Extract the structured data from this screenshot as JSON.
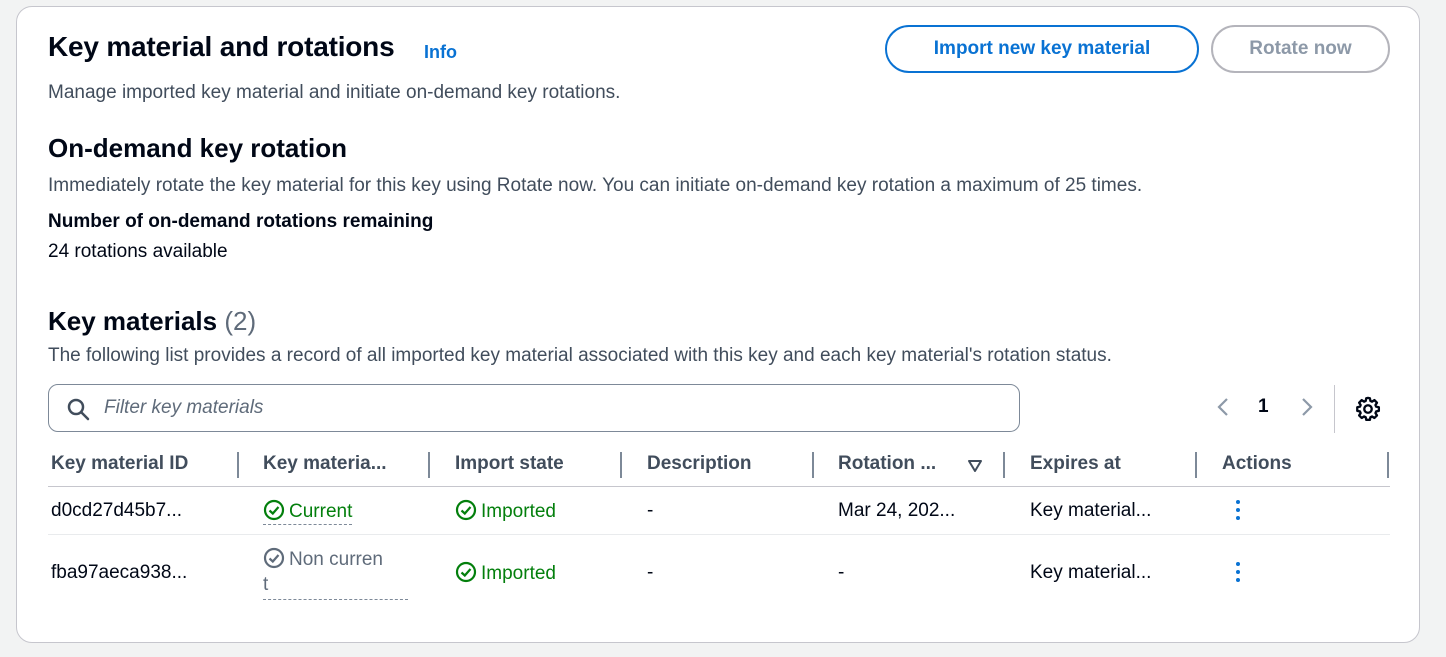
{
  "header": {
    "title": "Key material and rotations",
    "info_link": "Info",
    "description": "Manage imported key material and initiate on-demand key rotations.",
    "import_button": "Import new key material",
    "rotate_button": "Rotate now"
  },
  "on_demand": {
    "title": "On-demand key rotation",
    "description": "Immediately rotate the key material for this key using Rotate now. You can initiate on-demand key rotation a maximum of 25 times.",
    "remaining_label": "Number of on-demand rotations remaining",
    "remaining_value": "24 rotations available"
  },
  "key_materials": {
    "title": "Key materials",
    "count": "(2)",
    "description": "The following list provides a record of all imported key material associated with this key and each key material's rotation status.",
    "search_placeholder": "Filter key materials",
    "page": "1",
    "columns": [
      "Key material ID",
      "Key materia...",
      "Import state",
      "Description",
      "Rotation ...",
      "Expires at",
      "Actions"
    ],
    "rows": [
      {
        "id": "d0cd27d45b7...",
        "state": "Current",
        "import_state": "Imported",
        "description": "-",
        "rotation": "Mar 24, 202...",
        "expires": "Key material..."
      },
      {
        "id": "fba97aeca938...",
        "state_line1": "Non curren",
        "state_line2": "t",
        "import_state": "Imported",
        "description": "-",
        "rotation": "-",
        "expires": "Key material..."
      }
    ]
  },
  "colors": {
    "accent": "#0972d3",
    "success": "#037f0c",
    "muted": "#5f6b7a"
  },
  "icons": {
    "search": "search-icon",
    "prev": "chevron-left-icon",
    "next": "chevron-right-icon",
    "settings": "gear-icon",
    "status_current": "check-circle-icon",
    "status_non_current": "check-circle-outline-icon",
    "actions": "more-vertical-icon",
    "sort": "sort-descending-icon"
  }
}
